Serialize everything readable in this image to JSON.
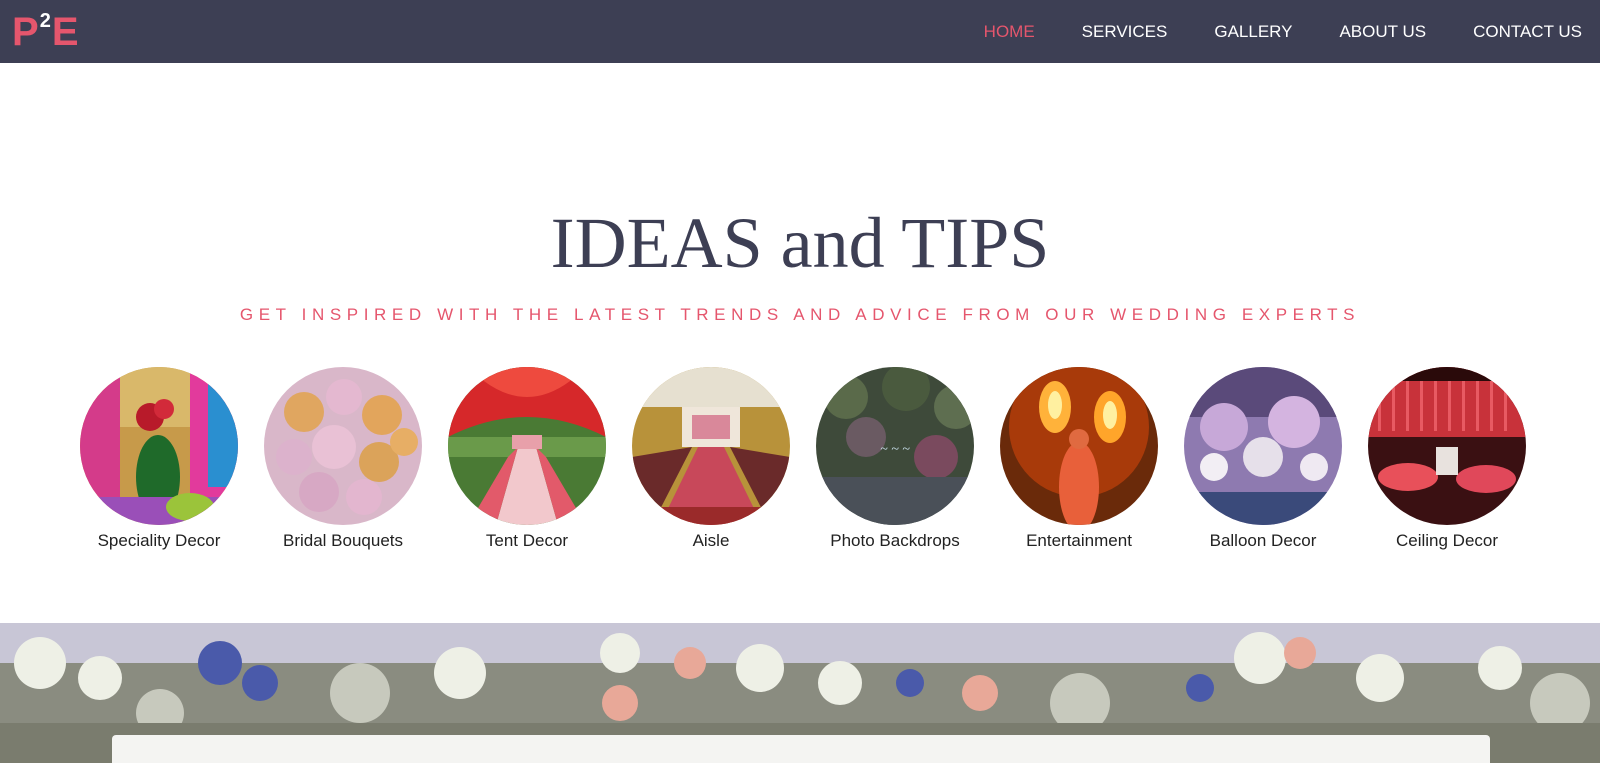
{
  "brand": {
    "logo_left": "P",
    "logo_sup": "2",
    "logo_right": "E"
  },
  "nav": {
    "items": [
      {
        "label": "HOME",
        "active": true
      },
      {
        "label": "SERVICES",
        "active": false
      },
      {
        "label": "GALLERY",
        "active": false
      },
      {
        "label": "ABOUT US",
        "active": false
      },
      {
        "label": "CONTACT US",
        "active": false
      }
    ]
  },
  "hero": {
    "title": "IDEAS and TIPS",
    "subtitle": "GET INSPIRED WITH THE LATEST TRENDS AND ADVICE FROM OUR WEDDING EXPERTS"
  },
  "categories": [
    {
      "label": "Speciality Decor",
      "image": "peacock-decor-photo"
    },
    {
      "label": "Bridal Bouquets",
      "image": "rose-bouquet-photo"
    },
    {
      "label": "Tent Decor",
      "image": "red-tent-aisle-photo"
    },
    {
      "label": "Aisle",
      "image": "ballroom-aisle-photo"
    },
    {
      "label": "Photo Backdrops",
      "image": "floral-wall-photo"
    },
    {
      "label": "Entertainment",
      "image": "fire-dancer-photo"
    },
    {
      "label": "Balloon Decor",
      "image": "chandelier-ceiling-photo"
    },
    {
      "label": "Ceiling Decor",
      "image": "red-ceiling-hall-photo"
    }
  ],
  "colors": {
    "navbar": "#3d3f54",
    "accent": "#e5566d",
    "title": "#3d3f54"
  }
}
